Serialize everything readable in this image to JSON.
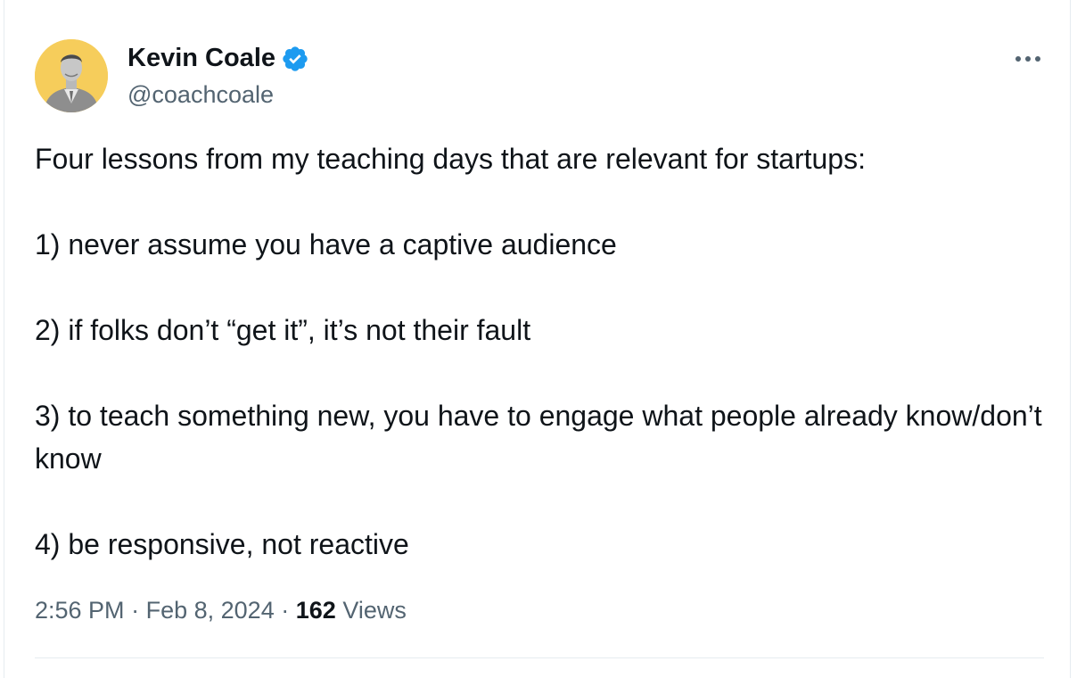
{
  "author": {
    "display_name": "Kevin Coale",
    "handle": "@coachcoale",
    "verified": true,
    "avatar_icon": "person-avatar",
    "avatar_bg": "#f6cd5b",
    "verified_color": "#1d9bf0"
  },
  "menu": {
    "more_icon": "more-horizontal-icon"
  },
  "tweet": {
    "intro": "Four lessons from my teaching days that are relevant for startups:",
    "lessons": [
      "1) never assume you have a captive audience",
      "2) if folks don’t “get it”, it’s not their fault",
      "3) to teach something new, you have to engage what people already know/don’t know",
      "4) be responsive, not reactive"
    ]
  },
  "meta": {
    "time": "2:56 PM",
    "separator": "·",
    "date": "Feb 8, 2024",
    "views_count": "162",
    "views_label": "Views"
  }
}
